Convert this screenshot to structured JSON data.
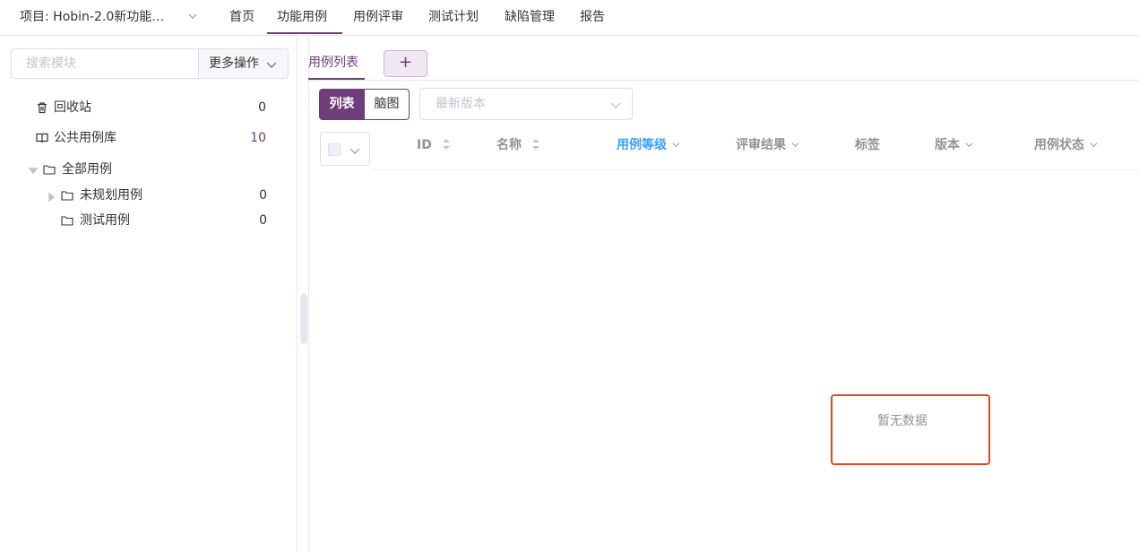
{
  "topnav": {
    "project_label": "项目: Hobin-2.0新功能…",
    "tabs": [
      {
        "label": "首页"
      },
      {
        "label": "功能用例"
      },
      {
        "label": "用例评审"
      },
      {
        "label": "测试计划"
      },
      {
        "label": "缺陷管理"
      },
      {
        "label": "报告"
      }
    ],
    "active_tab": "功能用例"
  },
  "sidebar": {
    "search": {
      "placeholder": "搜索模块",
      "value": ""
    },
    "more_actions_label": "更多操作",
    "items": [
      {
        "icon": "trash-icon",
        "label": "回收站",
        "count": "0"
      },
      {
        "icon": "book-icon",
        "label": "公共用例库",
        "count": "10"
      }
    ],
    "tree": {
      "root": {
        "label": "全部用例",
        "expanded": true
      },
      "children": [
        {
          "label": "未规划用例",
          "count": "0",
          "has_children": true
        },
        {
          "label": "测试用例",
          "count": "0",
          "has_children": false
        }
      ]
    }
  },
  "main": {
    "tab_label": "用例列表",
    "add_tab_label": "+",
    "view_toggle": {
      "list_label": "列表",
      "mind_label": "脑图",
      "active": "列表"
    },
    "version_select": {
      "placeholder": "最新版本",
      "value": ""
    },
    "columns": [
      {
        "label": "ID",
        "sortable": true
      },
      {
        "label": "名称",
        "sortable": true
      },
      {
        "label": "用例等级",
        "filter": true,
        "active": true
      },
      {
        "label": "评审结果",
        "filter": true
      },
      {
        "label": "标签"
      },
      {
        "label": "版本",
        "filter": true
      },
      {
        "label": "用例状态",
        "filter": true
      }
    ],
    "empty_text": "暂无数据"
  },
  "colors": {
    "accent": "#6e3d7a",
    "active_column": "#409eff",
    "highlight_border": "#e0492a"
  }
}
